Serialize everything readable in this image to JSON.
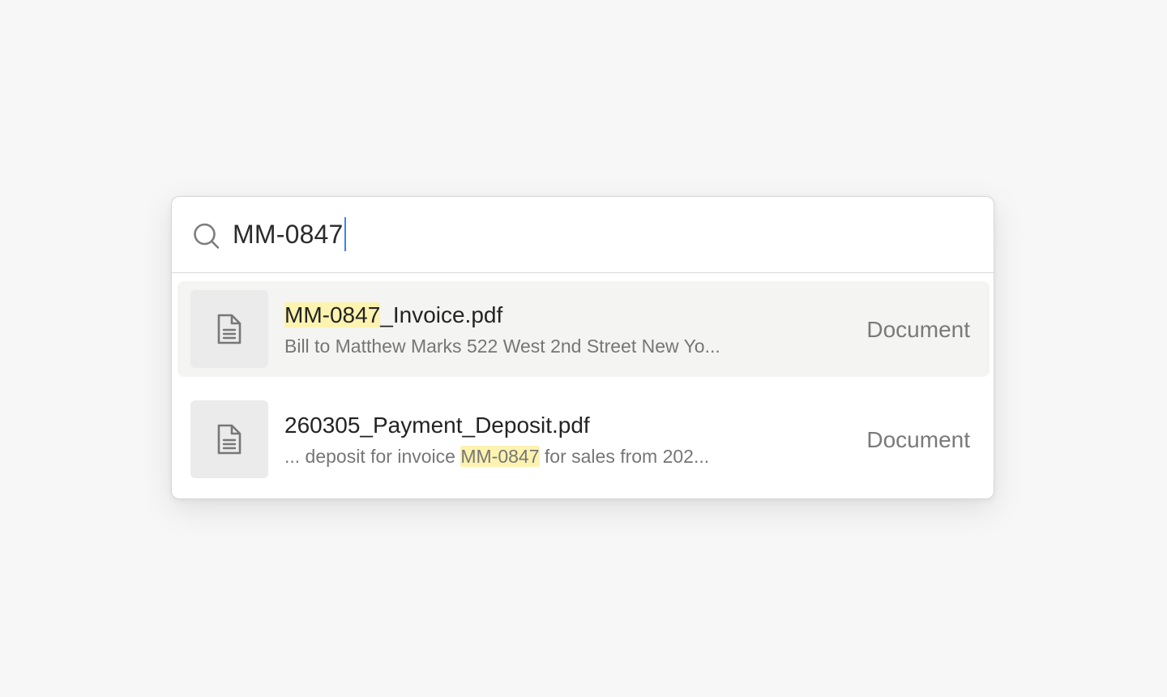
{
  "search": {
    "query": "MM-0847",
    "icon": "search-icon"
  },
  "colors": {
    "highlight": "#fdf3b0",
    "caret": "#3b82f6",
    "selected_row": "#f4f4f2"
  },
  "results": [
    {
      "icon": "document-icon",
      "title_match": "MM-0847",
      "title_rest": "_Invoice.pdf",
      "snippet": "Bill to Matthew Marks 522 West 2nd Street New Yo...",
      "type": "Document",
      "selected": true
    },
    {
      "icon": "document-icon",
      "title": "260305_Payment_Deposit.pdf",
      "snippet_before": "... deposit for invoice ",
      "snippet_match": "MM-0847",
      "snippet_after": " for sales from 202...",
      "type": "Document",
      "selected": false
    }
  ]
}
